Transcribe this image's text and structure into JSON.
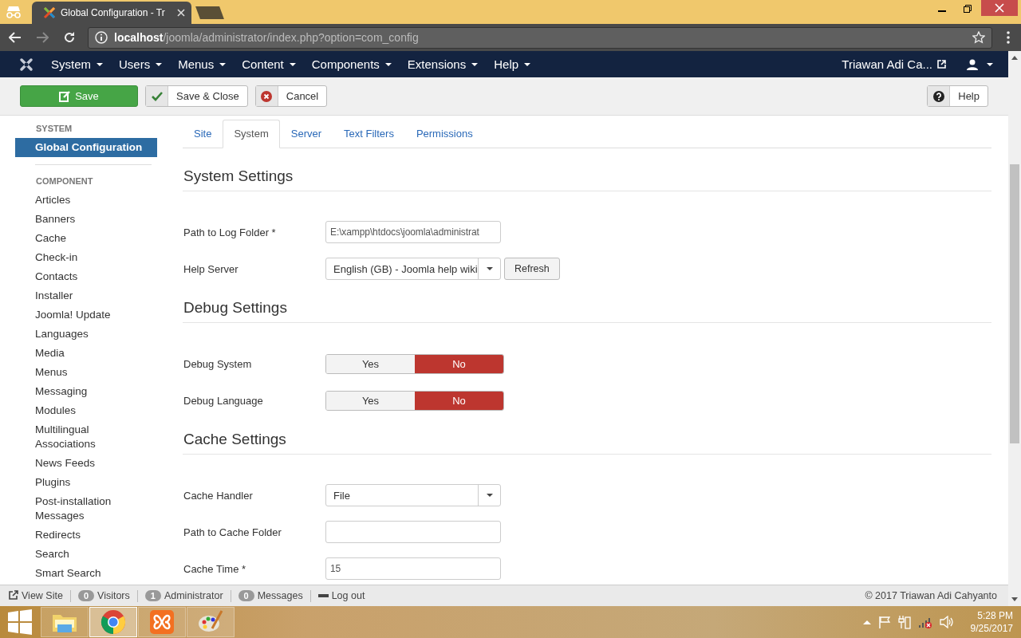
{
  "browser": {
    "tab_title": "Global Configuration - Tr",
    "address_host": "localhost",
    "address_path": "/joomla/administrator/index.php?option=com_config"
  },
  "navbar": {
    "menus": [
      "System",
      "Users",
      "Menus",
      "Content",
      "Components",
      "Extensions",
      "Help"
    ],
    "user": "Triawan Adi Ca..."
  },
  "toolbar": {
    "buttons": [
      {
        "label": "Save",
        "kind": "save"
      },
      {
        "label": "Save & Close",
        "kind": "check"
      },
      {
        "label": "Cancel",
        "kind": "cancel"
      }
    ],
    "help": "Help"
  },
  "sidebar": [
    {
      "heading": "SYSTEM",
      "items": [
        {
          "label": "Global Configuration",
          "selected": true
        }
      ]
    },
    {
      "heading": "COMPONENT",
      "items": [
        {
          "label": "Articles",
          "selected": false
        },
        {
          "label": "Banners",
          "selected": false
        },
        {
          "label": "Cache",
          "selected": false
        },
        {
          "label": "Check-in",
          "selected": false
        },
        {
          "label": "Contacts",
          "selected": false
        },
        {
          "label": "Installer",
          "selected": false
        },
        {
          "label": "Joomla! Update",
          "selected": false
        },
        {
          "label": "Languages",
          "selected": false
        },
        {
          "label": "Media",
          "selected": false
        },
        {
          "label": "Menus",
          "selected": false
        },
        {
          "label": "Messaging",
          "selected": false
        },
        {
          "label": "Modules",
          "selected": false
        },
        {
          "label": "Multilingual Associations",
          "selected": false
        },
        {
          "label": "News Feeds",
          "selected": false
        },
        {
          "label": "Plugins",
          "selected": false
        },
        {
          "label": "Post-installation Messages",
          "selected": false
        },
        {
          "label": "Redirects",
          "selected": false
        },
        {
          "label": "Search",
          "selected": false
        },
        {
          "label": "Smart Search",
          "selected": false
        }
      ]
    }
  ],
  "tabs": [
    {
      "label": "Site",
      "selected": false
    },
    {
      "label": "System",
      "selected": true
    },
    {
      "label": "Server",
      "selected": false
    },
    {
      "label": "Text Filters",
      "selected": false
    },
    {
      "label": "Permissions",
      "selected": false
    }
  ],
  "sections": [
    {
      "title": "System Settings",
      "fields": [
        {
          "label": "Path to Log Folder *",
          "kind": "text",
          "value": "E:\\xampp\\htdocs\\joomla\\administrat"
        },
        {
          "label": "Help Server",
          "kind": "select",
          "value": "English (GB) - Joomla help wiki",
          "button": "Refresh"
        }
      ]
    },
    {
      "title": "Debug Settings",
      "fields": [
        {
          "label": "Debug System",
          "kind": "toggle",
          "options": [
            {
              "label": "Yes",
              "selected": false
            },
            {
              "label": "No",
              "selected": true
            }
          ]
        },
        {
          "label": "Debug Language",
          "kind": "toggle",
          "options": [
            {
              "label": "Yes",
              "selected": false
            },
            {
              "label": "No",
              "selected": true
            }
          ]
        }
      ]
    },
    {
      "title": "Cache Settings",
      "fields": [
        {
          "label": "Cache Handler",
          "kind": "select",
          "value": "File"
        },
        {
          "label": "Path to Cache Folder",
          "kind": "text"
        },
        {
          "label": "Cache Time *",
          "kind": "text",
          "value": "15"
        }
      ]
    }
  ],
  "status_bar": {
    "items": [
      {
        "kind": "link",
        "label": "View Site"
      },
      {
        "kind": "count",
        "count": "0",
        "label": "Visitors"
      },
      {
        "kind": "count",
        "count": "1",
        "label": "Administrator"
      },
      {
        "kind": "count",
        "count": "0",
        "label": "Messages"
      },
      {
        "kind": "logout",
        "label": "Log out"
      }
    ],
    "copyright": "© 2017 Triawan Adi Cahyanto"
  },
  "taskbar": {
    "apps": [
      {
        "kind": "explorer",
        "selected": false
      },
      {
        "kind": "chrome",
        "selected": true
      },
      {
        "kind": "xampp",
        "selected": false
      },
      {
        "kind": "paint",
        "selected": false
      }
    ],
    "time": "5:28 PM",
    "date": "9/25/2017"
  }
}
